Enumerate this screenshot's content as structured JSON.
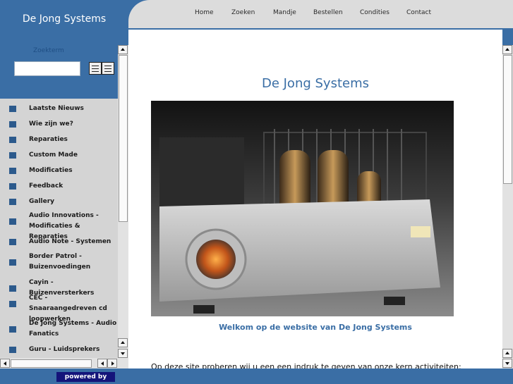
{
  "left": {
    "brand": "De Jong Systems",
    "search": {
      "label": "Zoekterm",
      "value": "",
      "placeholder": ""
    },
    "nav_items": [
      {
        "label": "Laatste Nieuws"
      },
      {
        "label": "Wie zijn we?"
      },
      {
        "label": "Reparaties"
      },
      {
        "label": "Custom Made"
      },
      {
        "label": "Modificaties"
      },
      {
        "label": "Feedback"
      },
      {
        "label": "Gallery"
      },
      {
        "label": "Audio Innovations - Modificaties & Reparaties"
      },
      {
        "label": "Audio Note - Systemen"
      },
      {
        "label": "Border Patrol - Buizenvoedingen"
      },
      {
        "label": "Cayin - Buizenversterkers"
      },
      {
        "label": "CEC - Snaaraangedreven cd loopwerken"
      },
      {
        "label": "De Jong Systems - Audio Fanatics"
      },
      {
        "label": "Guru - Luidsprekers"
      }
    ]
  },
  "topnav": [
    "Home",
    "Zoeken",
    "Mandje",
    "Bestellen",
    "Condities",
    "Contact"
  ],
  "main": {
    "title": "De Jong Systems",
    "hero_caption": "Welkom op de website van De Jong Systems",
    "intro": "Op deze site proberen wij u een een indruk te geven van onze kern activiteiten:"
  },
  "footer": {
    "powered_by": "powered by"
  },
  "colors": {
    "brand_blue": "#3a6ea5",
    "nav_bg": "#d4d4d4",
    "bullet": "#2c5a8c",
    "powered_bg": "#14147a"
  }
}
